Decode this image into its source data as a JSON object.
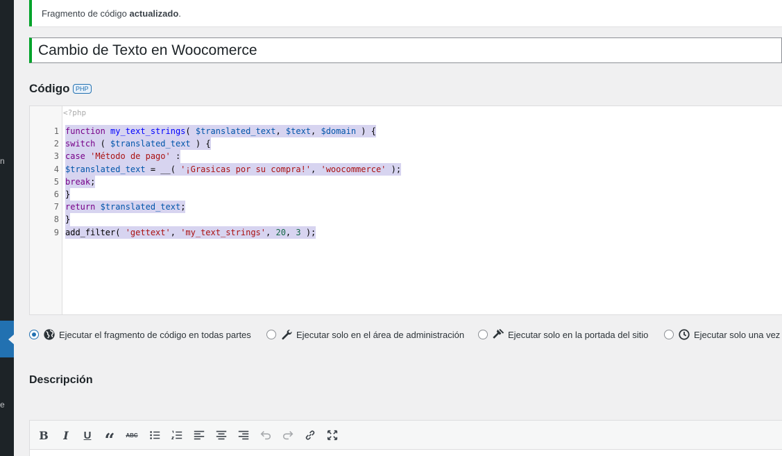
{
  "notice": {
    "prefix": "Fragmento de código ",
    "bold": "actualizado",
    "suffix": "."
  },
  "snippet_title": "Cambio de Texto en Woocomerce",
  "code_section": {
    "heading": "Código",
    "badge": "PHP",
    "php_open_tag": "<?php"
  },
  "code_lines": [
    {
      "n": "1",
      "text": "function my_text_strings( $translated_text, $text, $domain ) {"
    },
    {
      "n": "2",
      "text": "switch ( $translated_text ) {"
    },
    {
      "n": "3",
      "text": "case 'Método de pago' :"
    },
    {
      "n": "4",
      "text": "$translated_text = __( '¡Grasicas por su compra!', 'woocommerce' );"
    },
    {
      "n": "5",
      "text": "break;"
    },
    {
      "n": "6",
      "text": "}"
    },
    {
      "n": "7",
      "text": "return $translated_text;"
    },
    {
      "n": "8",
      "text": "}"
    },
    {
      "n": "9",
      "text": "add_filter( 'gettext', 'my_text_strings', 20, 3 );"
    }
  ],
  "scope_options": [
    {
      "label": "Ejecutar el fragmento de código en todas partes",
      "icon": "globe-icon",
      "checked": true
    },
    {
      "label": "Ejecutar solo en el área de administración",
      "icon": "wrench-icon",
      "checked": false
    },
    {
      "label": "Ejecutar solo en la portada del sitio",
      "icon": "hammer-icon",
      "checked": false
    },
    {
      "label": "Ejecutar solo una vez",
      "icon": "clock-icon",
      "checked": false
    }
  ],
  "description": {
    "heading": "Descripción"
  },
  "toolbar": {
    "bold": "B",
    "italic": "I",
    "underline": "U",
    "blockquote": "“",
    "strikethrough": "ABC"
  },
  "colors": {
    "accent": "#2271b1",
    "success": "#00a32a",
    "sidebar": "#1d2327"
  }
}
